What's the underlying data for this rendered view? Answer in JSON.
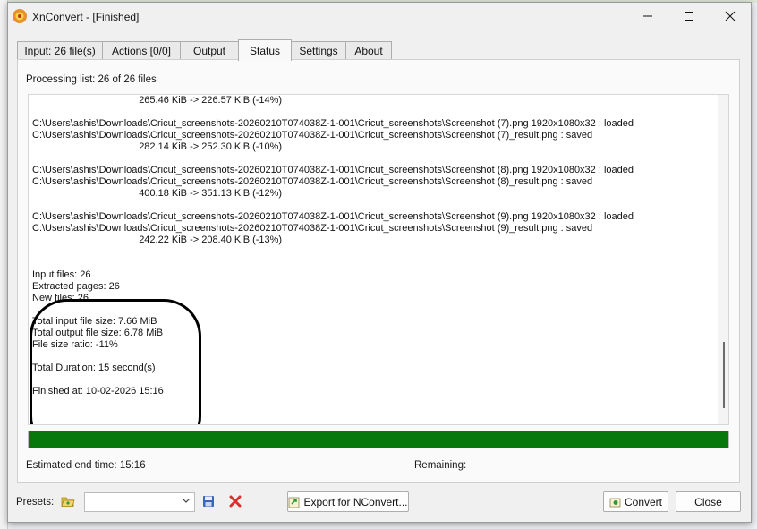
{
  "window": {
    "title": "XnConvert - [Finished]"
  },
  "tabs": [
    {
      "label": "Input: 26 file(s)"
    },
    {
      "label": "Actions [0/0]"
    },
    {
      "label": "Output"
    },
    {
      "label": "Status"
    },
    {
      "label": "Settings"
    },
    {
      "label": "About"
    }
  ],
  "status": {
    "processing_label": "Processing list:  26 of 26 files",
    "log_lines": [
      "                                       265.46 KiB -> 226.57 KiB (-14%)",
      "",
      "C:\\Users\\ashis\\Downloads\\Cricut_screenshots-20260210T074038Z-1-001\\Cricut_screenshots\\Screenshot (7).png 1920x1080x32 : loaded",
      "C:\\Users\\ashis\\Downloads\\Cricut_screenshots-20260210T074038Z-1-001\\Cricut_screenshots\\Screenshot (7)_result.png : saved",
      "                                       282.14 KiB -> 252.30 KiB (-10%)",
      "",
      "C:\\Users\\ashis\\Downloads\\Cricut_screenshots-20260210T074038Z-1-001\\Cricut_screenshots\\Screenshot (8).png 1920x1080x32 : loaded",
      "C:\\Users\\ashis\\Downloads\\Cricut_screenshots-20260210T074038Z-1-001\\Cricut_screenshots\\Screenshot (8)_result.png : saved",
      "                                       400.18 KiB -> 351.13 KiB (-12%)",
      "",
      "C:\\Users\\ashis\\Downloads\\Cricut_screenshots-20260210T074038Z-1-001\\Cricut_screenshots\\Screenshot (9).png 1920x1080x32 : loaded",
      "C:\\Users\\ashis\\Downloads\\Cricut_screenshots-20260210T074038Z-1-001\\Cricut_screenshots\\Screenshot (9)_result.png : saved",
      "                                       242.22 KiB -> 208.40 KiB (-13%)",
      "",
      "",
      "Input files: 26",
      "Extracted pages: 26",
      "New files: 26",
      "",
      "Total input file size: 7.66 MiB",
      "Total output file size: 6.78 MiB",
      "File size ratio: -11%",
      "",
      "Total Duration: 15 second(s)",
      "",
      "Finished at: 10-02-2026 15:16"
    ],
    "progress_fraction": 1.0,
    "estimated_end_label": "Estimated end time:  15:16",
    "remaining_label": "Remaining:"
  },
  "footer": {
    "presets_label": "Presets:",
    "presets_selected": "",
    "export_label": "Export for NConvert...",
    "convert_label": "Convert",
    "close_label": "Close"
  },
  "colors": {
    "progress": "#06780c",
    "delete_icon": "#d9302c",
    "save_icon": "#3a66b5"
  },
  "icons": {
    "app": "xnconvert-logo-icon",
    "open": "folder-open-icon",
    "save": "floppy-disk-icon",
    "delete": "delete-x-icon",
    "export": "export-icon",
    "convert": "convert-icon"
  }
}
